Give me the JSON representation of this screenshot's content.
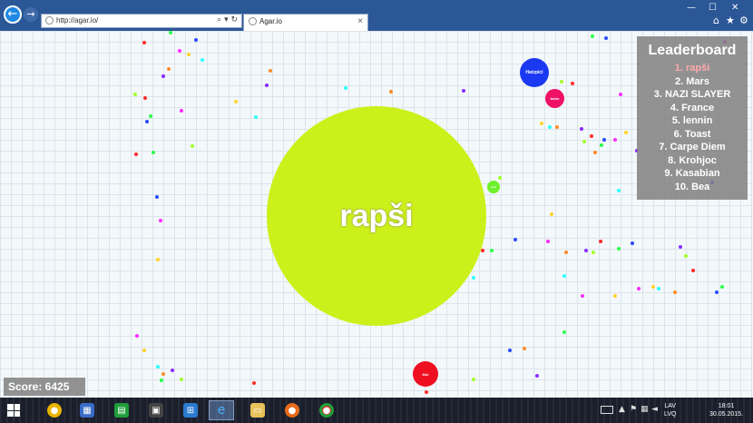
{
  "browser": {
    "address": "http://agar.io/",
    "tab_title": "Agar.io",
    "tab_close": "×"
  },
  "game": {
    "player_name": "rapši",
    "cells": [
      {
        "name": "Hatzpici",
        "color": "#1b39f0"
      },
      {
        "name": "bobo",
        "color": "#ee1165"
      },
      {
        "name": "Moi",
        "color": "#ee1020"
      },
      {
        "name": "nazi",
        "color": "#6ef02a"
      }
    ],
    "player_color": "#ccf01a"
  },
  "leaderboard": {
    "title": "Leaderboard",
    "entries": [
      "1. rapši",
      "2. Mars",
      "3. NAZI SLAYER",
      "4. France",
      "5. lennin",
      "6. Toast",
      "7. Carpe Diem",
      "8. Krohjoc",
      "9. Kasabian",
      "10. Bea"
    ]
  },
  "score": {
    "label": "Score: 6425"
  },
  "taskbar": {
    "language_top": "LAV",
    "language_bottom": "LVQ",
    "time": "18:01",
    "date": "30.05.2015."
  }
}
